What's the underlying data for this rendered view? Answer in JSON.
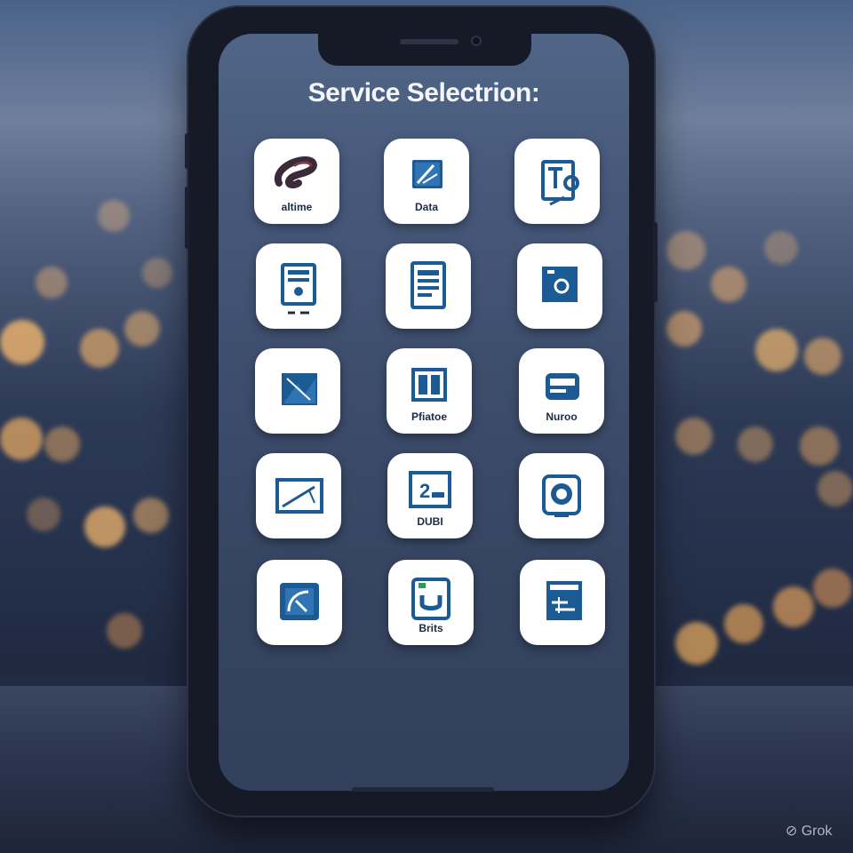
{
  "screen": {
    "title": "Service Selectrion:"
  },
  "services": [
    {
      "label": "altime",
      "icon": "airtel-logo-icon"
    },
    {
      "label": "Data",
      "icon": "data-icon"
    },
    {
      "label": "",
      "icon": "tc-icon"
    },
    {
      "label": "",
      "icon": "bill-document-icon"
    },
    {
      "label": "",
      "icon": "document-icon"
    },
    {
      "label": "",
      "icon": "camera-icon"
    },
    {
      "label": "",
      "icon": "image-icon"
    },
    {
      "label": "Pfiatoe",
      "icon": "photo-frame-icon"
    },
    {
      "label": "Nuroo",
      "icon": "device-icon"
    },
    {
      "label": "",
      "icon": "tablet-icon"
    },
    {
      "label": "DUBI",
      "icon": "display-icon"
    },
    {
      "label": "",
      "icon": "gauge-icon"
    },
    {
      "label": "",
      "icon": "satellite-icon"
    },
    {
      "label": "Brits",
      "icon": "phone-card-icon"
    },
    {
      "label": "",
      "icon": "ticket-icon"
    }
  ],
  "watermark": "Grok",
  "colors": {
    "accent": "#1c5a93",
    "tile": "#ffffff",
    "title": "#f4f6fa"
  }
}
